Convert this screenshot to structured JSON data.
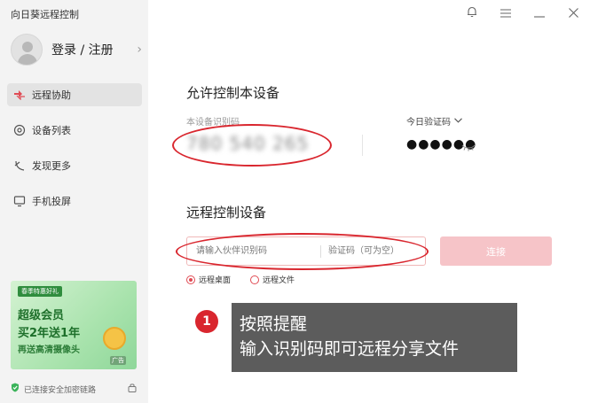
{
  "app": {
    "title": "向日葵远程控制"
  },
  "sidebar": {
    "login_label": "登录 / 注册",
    "items": [
      {
        "label": "远程协助",
        "icon": "remote-assist-icon",
        "active": true
      },
      {
        "label": "设备列表",
        "icon": "device-list-icon",
        "active": false
      },
      {
        "label": "发现更多",
        "icon": "discover-icon",
        "active": false
      },
      {
        "label": "手机投屏",
        "icon": "screen-cast-icon",
        "active": false
      }
    ],
    "ad": {
      "tag": "春季特惠好礼",
      "line1": "超级会员",
      "line2": "买2年送1年",
      "line3": "再送高清摄像头",
      "badge": "广告"
    },
    "footer": "已连接安全加密链路"
  },
  "allow_control": {
    "title": "允许控制本设备",
    "device_id_label": "本设备识别码",
    "device_id_value": "780 540 265",
    "code_label": "今日验证码",
    "code_value": "●●●●●●"
  },
  "remote_control": {
    "title": "远程控制设备",
    "partner_placeholder": "请输入伙伴识别码",
    "code_placeholder": "验证码（可为空）",
    "connect_label": "连接",
    "options": [
      {
        "label": "远程桌面",
        "selected": true
      },
      {
        "label": "远程文件",
        "selected": false
      }
    ]
  },
  "annotation": {
    "step": "1",
    "line1": "按照提醒",
    "line2": "输入识别码即可远程分享文件"
  },
  "colors": {
    "accent": "#e04b54",
    "connect_disabled": "#f6c4c8",
    "annotation_red": "#d9262e"
  }
}
